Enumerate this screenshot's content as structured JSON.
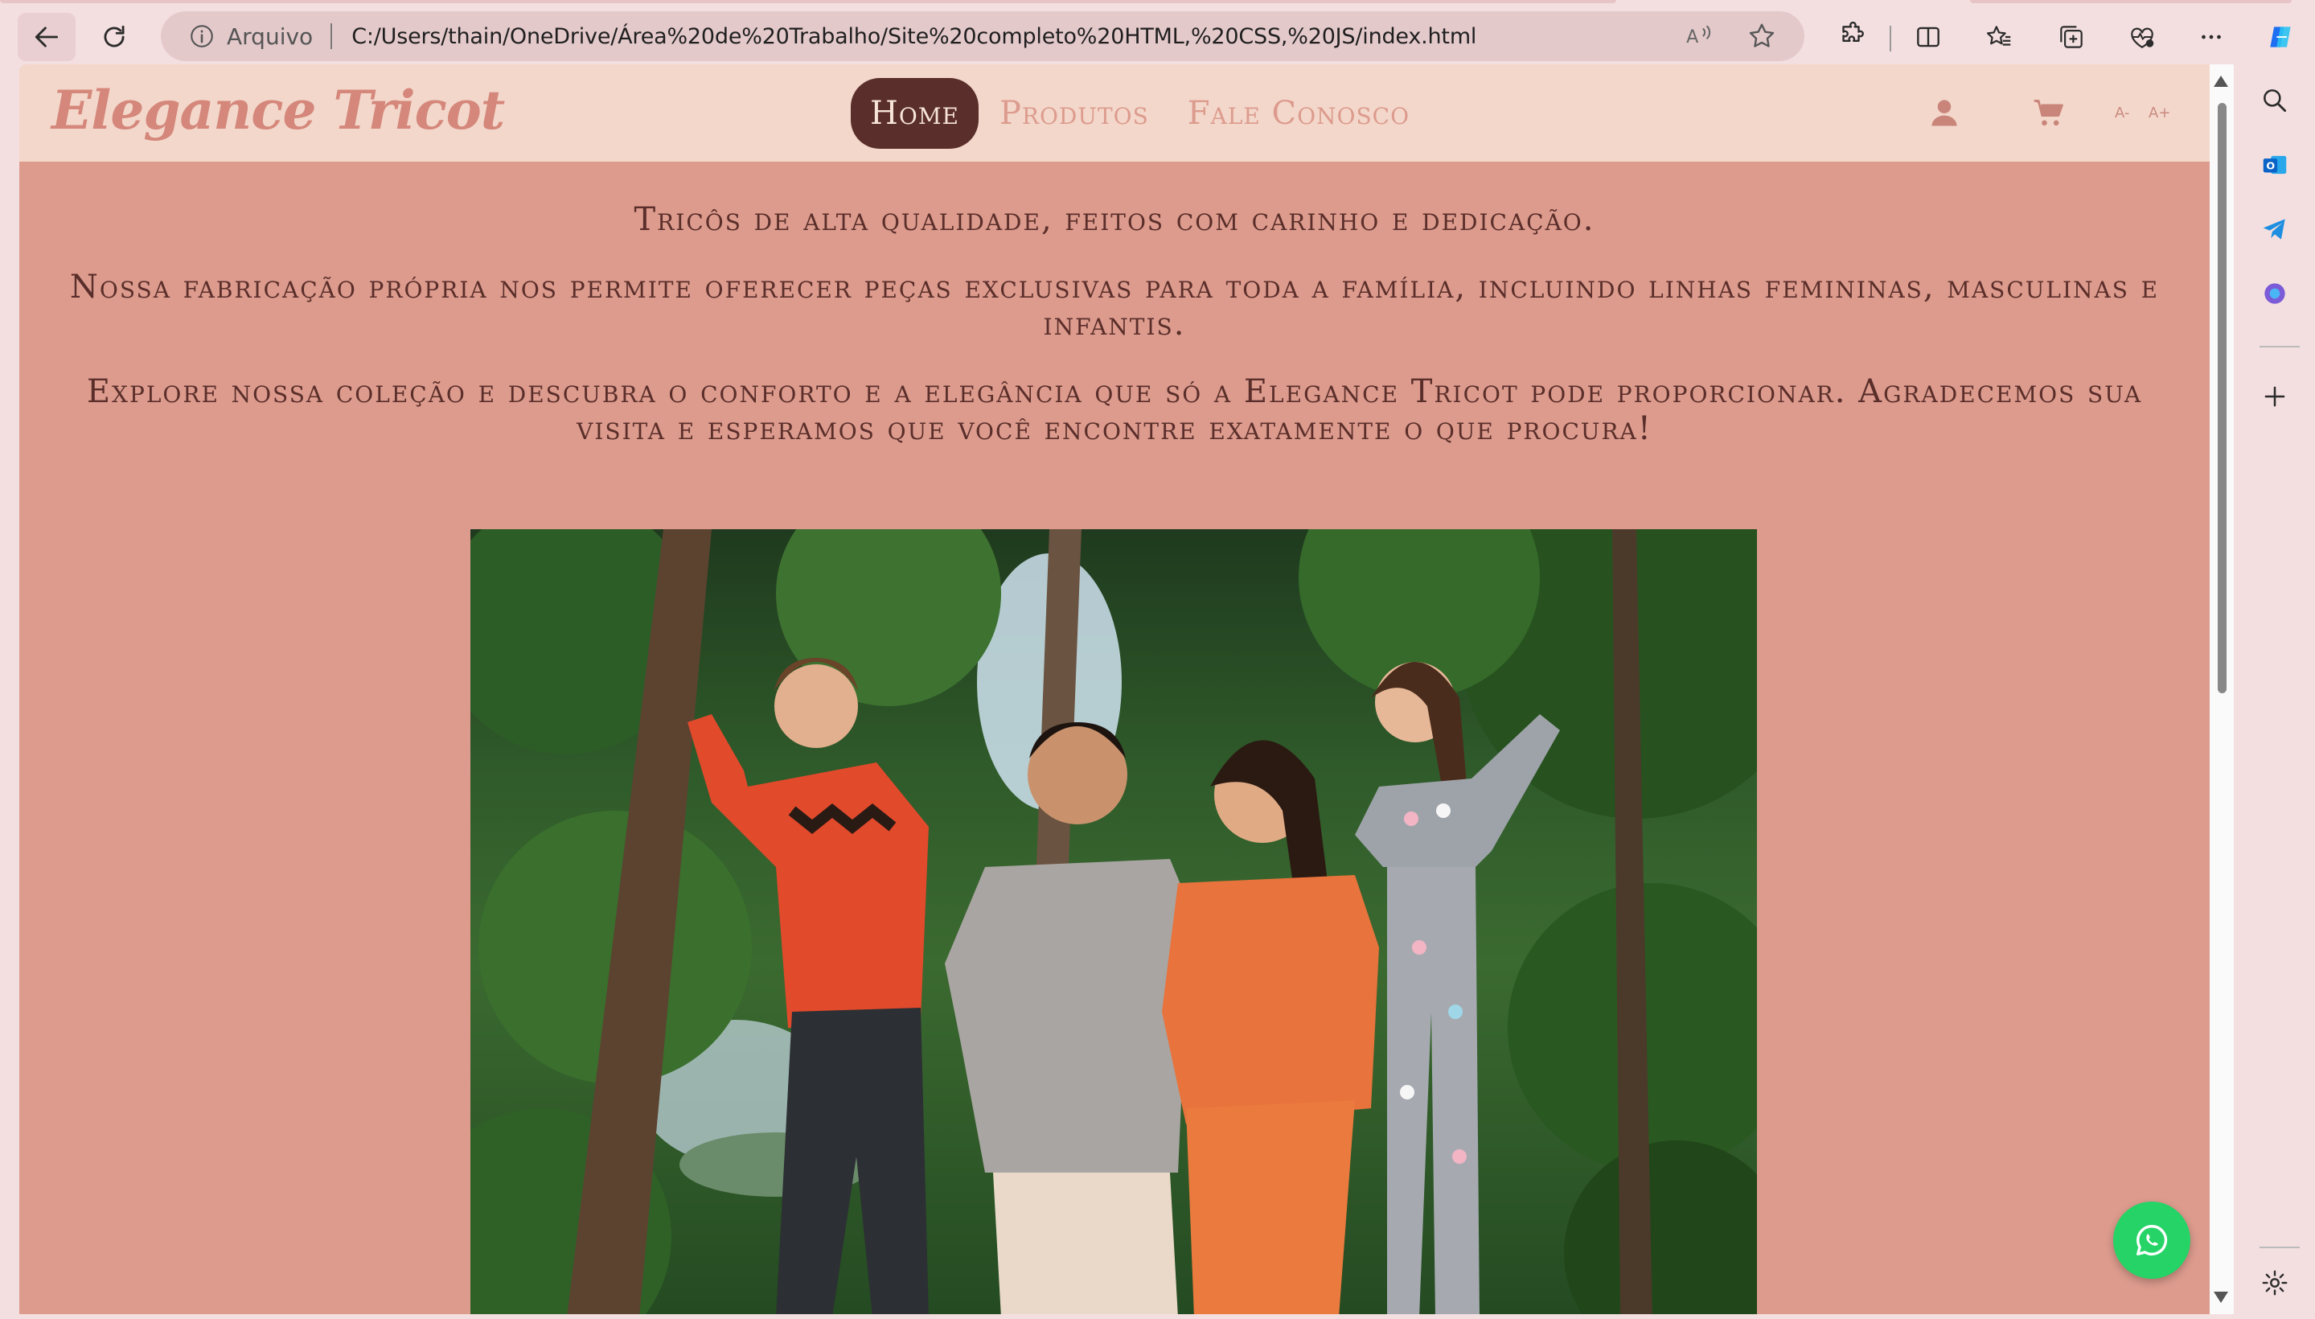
{
  "browser": {
    "address_label": "Arquivo",
    "url": "C:/Users/thain/OneDrive/Área%20de%20Trabalho/Site%20completo%20HTML,%20CSS,%20JS/index.html",
    "icons": {
      "back": "back-arrow-icon",
      "reload": "reload-icon",
      "info": "info-icon",
      "read_aloud": "read-aloud-icon",
      "favorite": "star-icon",
      "extensions": "puzzle-icon",
      "split_screen": "split-screen-icon",
      "favorites": "favorites-icon",
      "collections": "collections-icon",
      "browser_essentials": "heart-pulse-icon",
      "more": "more-icon",
      "copilot": "copilot-icon"
    }
  },
  "sidebar": {
    "items": [
      "search-icon",
      "outlook-icon",
      "telegram-icon",
      "copilot-app-icon",
      "add-icon",
      "settings-icon"
    ]
  },
  "site": {
    "logo": "Elegance Tricot",
    "nav": [
      {
        "label": "Home",
        "active": true
      },
      {
        "label": "Produtos",
        "active": false
      },
      {
        "label": "Fale Conosco",
        "active": false
      }
    ],
    "font_decrease": "A-",
    "font_increase": "A+",
    "intro": {
      "p1": "Tricôs de alta qualidade, feitos com carinho e dedicação.",
      "p2": "Nossa fabricação própria nos permite oferecer peças exclusivas para toda a família, incluindo linhas femininas, masculinas e infantis.",
      "p3": "Explore nossa coleção e descubra o conforto e a elegância que só a Elegance Tricot pode proporcionar. Agradecemos sua visita e esperamos que você encontre exatamente o que procura!"
    },
    "colors": {
      "header_bg": "#f3d7cb",
      "page_bg": "#dc9b8d",
      "accent_dark": "#5a2e2a",
      "logo": "#d4877a",
      "whatsapp": "#25d366"
    }
  }
}
